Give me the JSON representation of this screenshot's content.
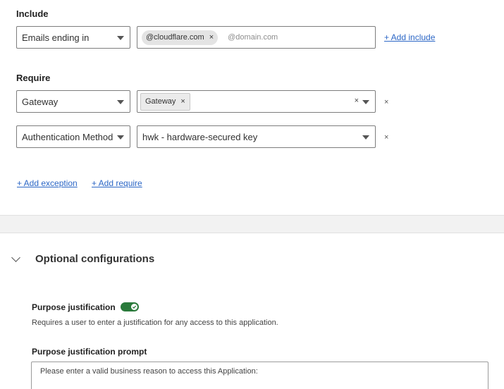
{
  "include": {
    "heading": "Include",
    "selector_value": "Emails ending in",
    "chip_label": "@cloudflare.com",
    "chip_remove": "×",
    "input_placeholder": "@domain.com",
    "add_link": "+ Add include"
  },
  "require": {
    "heading": "Require",
    "rows": [
      {
        "selector_value": "Gateway",
        "chip_label": "Gateway",
        "chip_remove": "×",
        "clear": "×",
        "row_remove": "×"
      },
      {
        "selector_value": "Authentication Method",
        "value": "hwk - hardware-secured key",
        "row_remove": "×"
      }
    ],
    "add_exception_link": "+ Add exception",
    "add_require_link": "+ Add require"
  },
  "optional": {
    "title": "Optional configurations",
    "purpose_justification_label": "Purpose justification",
    "purpose_justification_enabled": true,
    "purpose_justification_description": "Requires a user to enter a justification for any access to this application.",
    "prompt_label": "Purpose justification prompt",
    "prompt_value": "Please enter a valid business reason to access this Application:"
  },
  "colors": {
    "link": "#2c67c6",
    "toggle_on": "#2a7a3b"
  }
}
